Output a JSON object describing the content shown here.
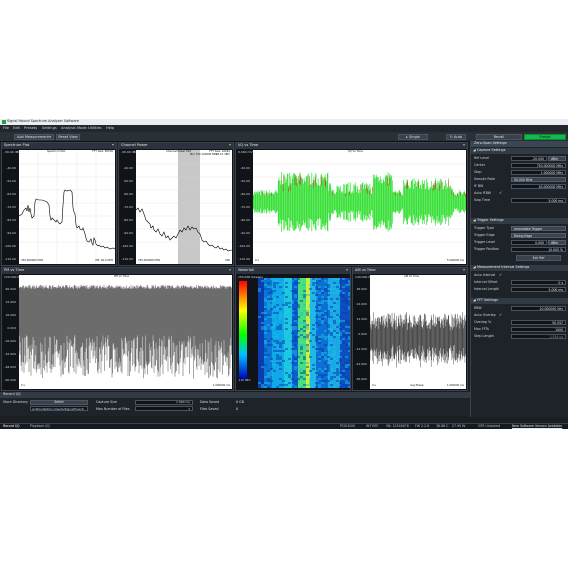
{
  "window": {
    "title": "Signal Hound Spectrum Analyzer Software"
  },
  "menu": [
    "File",
    "Edit",
    "Presets",
    "Settings",
    "Analysis Mode",
    "Utilities",
    "Help"
  ],
  "toolbar": {
    "add_measurement": "Add Measurement",
    "reset_view": "Reset View",
    "single": "Single",
    "auto": "Auto",
    "recall": "Recall",
    "preset": "Preset"
  },
  "panels": {
    "spectrum": {
      "title": "Spectrum Plot",
      "ref": "-30.00 dBm",
      "inner": "Spectrum Plot",
      "fft": "FFT Size: 65536",
      "y_ticks": [
        "-40.00",
        "-50.00",
        "-60.00",
        "-70.00",
        "-80.00",
        "-90.00",
        "-100.00",
        "-110.00"
      ],
      "bottom_left": "760.000000 MHz",
      "bottom_right": "PM: 40.0 MHz"
    },
    "channel_power": {
      "title": "Channel Power",
      "ref": "-30.00 dBm",
      "inner": "Channel Power Plot",
      "fft": "FFT Size: 16061",
      "y_ticks": [
        "-40.00",
        "-50.00",
        "-60.00",
        "-70.00",
        "-80.00",
        "-90.00",
        "-100.00",
        "-110.00"
      ],
      "marker": "Mkr 750.100000 MHz",
      "marker_val": "-93.23 dBm",
      "bottom_left": "750.000000 MHz",
      "bottom_right": "SPA"
    },
    "iq": {
      "title": "I/Q vs Time",
      "ref": "0.000 mV",
      "inner": "I/Q Vs Time",
      "y_ticks": [
        "-40.00",
        "-50.00",
        "-60.00",
        "-70.00",
        "-80.00",
        "-90.00",
        "-100.00",
        "-110.00"
      ],
      "bottom_left": "0 s",
      "bottom_right": "5.000000 ms"
    },
    "pm": {
      "title": "PM vs Time",
      "ref": "120.000 MHz",
      "inner": "PM Vs Time",
      "y_ticks": [
        "60.000",
        "32.000",
        "16.000",
        "0.000",
        "-16.000",
        "-32.000",
        "-48.000",
        "-60.000"
      ],
      "bottom_left": "0 s",
      "bottom_right": "1.000000 ms"
    },
    "waterfall": {
      "title": "Waterfall",
      "ref": "150.000 Sweeps",
      "scale_top": "-30 dBm",
      "scale_bottom": "-110 dBm"
    },
    "am": {
      "title": "AM vs Time",
      "ref": "140.000 MHz",
      "inner": "AM Vs Time",
      "y_ticks": [
        "36.000",
        "24.000",
        "12.000",
        "0.000",
        "-12.000",
        "-24.000",
        "-36.000"
      ],
      "bottom_left": "0 s",
      "bottom_right": "1.000000 ms",
      "bottom_mid": "Avg Phase:"
    }
  },
  "sidebar": {
    "title": "Zero-Span Settings",
    "capture": {
      "head": "Capture Settings",
      "ref_level_label": "Ref Level",
      "ref_level": "-20.000",
      "ref_level_unit": "dBm",
      "center_label": "Center",
      "center": "750.000000 MHz",
      "step_label": "Step",
      "step": "1.000000 MHz",
      "sample_rate_label": "Sample Rate",
      "sample_rate": "50.000 MHz",
      "ibw_label": "IF BW",
      "ibw": "40.000000 MHz",
      "auto_ifbw_label": "Auto IFBW",
      "auto_ifbw": "✓",
      "sweep_label": "Swp Time",
      "sweep": "5.000 ms"
    },
    "trigger": {
      "head": "Trigger Settings",
      "type_label": "Trigger Type",
      "type": "Immediate Trigger",
      "edge_label": "Trigger Edge",
      "edge": "Rising Edge",
      "level_label": "Trigger Level",
      "level": "0.000",
      "level_unit": "dBm",
      "position_label": "Trigger Position",
      "position": "10.000 %",
      "exit_label": "Exit Ref"
    },
    "interval": {
      "head": "Measurement Interval Settings",
      "auto_label": "Auto Interval",
      "auto": "✓",
      "offset_label": "Interval Offset",
      "offset": "0 s",
      "length_label": "Interval Length",
      "length": "5.000 ms"
    },
    "fft": {
      "head": "FFT Settings",
      "rbw_label": "RBW",
      "rbw": "10.000000 kHz",
      "auto_overlap_label": "Auto Overlap",
      "auto_overlap": "✓",
      "overlap_label": "Overlap %",
      "overlap": "50.937",
      "max_ffts_label": "Max FFTs",
      "max_ffts": "1000",
      "step_label": "Step Length",
      "step": "2.554 us"
    }
  },
  "record": {
    "head": "Record I/Q",
    "store_label": "Store Directory",
    "select": "Select",
    "path": "ar.Shindel/Documents/SignalHound/",
    "capture_size_label": "Capture Size",
    "capture_size": "1.000 ms",
    "max_files_label": "Max Number of Files",
    "max_files": "1",
    "data_saved_label": "Data Saved",
    "data_saved": "0 GB",
    "files_saved_label": "Files Saved",
    "files_saved": "0"
  },
  "tabs": [
    "Record I/Q",
    "Playback I/Q"
  ],
  "status": [
    "PCIE4200",
    "INT REF",
    "SN: 12345678",
    "FW 2.2.8",
    "38.88 C",
    "27.99 W",
    "GPS Unlocked",
    "New Software Version Available"
  ],
  "colors": {
    "accent": "#17b84a",
    "trace": "#000000",
    "iq_i": "#22dd22",
    "iq_q": "#dd2222"
  }
}
